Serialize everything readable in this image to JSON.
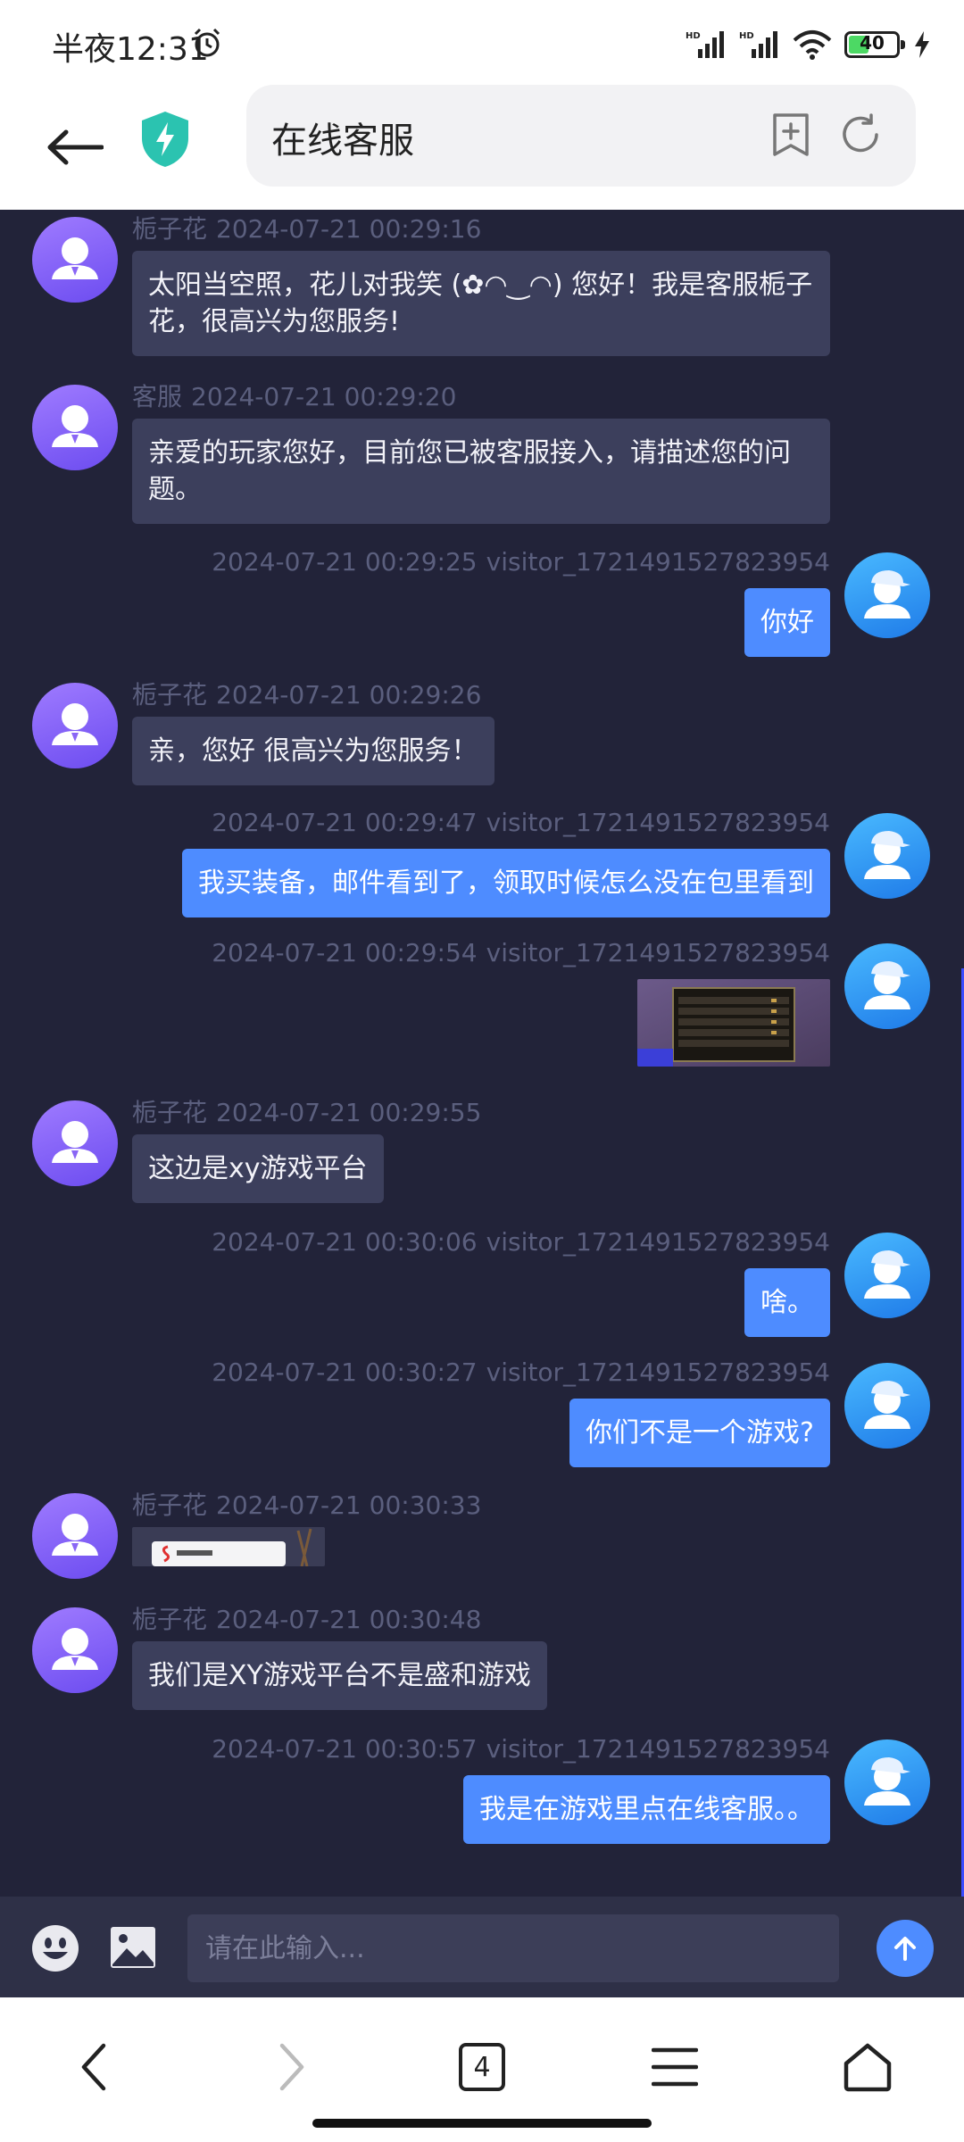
{
  "status_bar": {
    "time": "半夜12:31",
    "battery_level": "40"
  },
  "toolbar": {
    "title": "在线客服"
  },
  "chat": {
    "messages": [
      {
        "side": "staff",
        "name": "栀子花",
        "time": "2024-07-21 00:29:16",
        "text_lines": [
          "太阳当空照，花儿对我笑 (✿◠‿◠) 您好！我是客服栀子",
          "花，很高兴为您服务!"
        ]
      },
      {
        "side": "staff",
        "name": "客服",
        "time": "2024-07-21 00:29:20",
        "text_lines": [
          "亲爱的玩家您好，目前您已被客服接入，请描述您的问",
          "题。"
        ]
      },
      {
        "side": "visitor",
        "name": "visitor_1721491527823954",
        "time": "2024-07-21 00:29:25",
        "text": "你好"
      },
      {
        "side": "staff",
        "name": "栀子花",
        "time": "2024-07-21 00:29:26",
        "text": "亲，您好 很高兴为您服务！"
      },
      {
        "side": "visitor",
        "name": "visitor_1721491527823954",
        "time": "2024-07-21 00:29:47",
        "text": "我买装备，邮件看到了，领取时候怎么没在包里看到"
      },
      {
        "side": "visitor",
        "name": "visitor_1721491527823954",
        "time": "2024-07-21 00:29:54",
        "image": "game-screenshot"
      },
      {
        "side": "staff",
        "name": "栀子花",
        "time": "2024-07-21 00:29:55",
        "text": "这边是xy游戏平台"
      },
      {
        "side": "visitor",
        "name": "visitor_1721491527823954",
        "time": "2024-07-21 00:30:06",
        "text": "啥。"
      },
      {
        "side": "visitor",
        "name": "visitor_1721491527823954",
        "time": "2024-07-21 00:30:27",
        "text": "你们不是一个游戏?"
      },
      {
        "side": "staff",
        "name": "栀子花",
        "time": "2024-07-21 00:30:33",
        "image": "platform-logo-image"
      },
      {
        "side": "staff",
        "name": "栀子花",
        "time": "2024-07-21 00:30:48",
        "text": "我们是XY游戏平台不是盛和游戏"
      },
      {
        "side": "visitor",
        "name": "visitor_1721491527823954",
        "time": "2024-07-21 00:30:57",
        "text": "我是在游戏里点在线客服。。"
      }
    ]
  },
  "input": {
    "placeholder": "请在此输入..."
  },
  "bottom_nav": {
    "tabs_count": "4"
  },
  "colors": {
    "chat_bg": "#222339",
    "staff_bubble": "#3c3f5c",
    "visitor_bubble": "#4e8cff",
    "accent": "#4e8cff"
  }
}
